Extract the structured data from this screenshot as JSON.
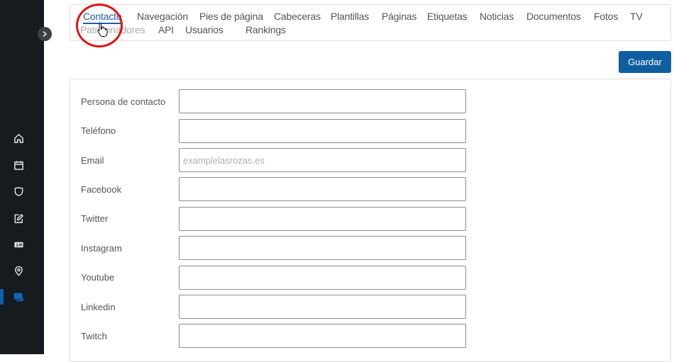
{
  "sidebar": {
    "toggle_icon": "chevron-right-icon",
    "items": [
      {
        "name": "home",
        "icon": "home-icon",
        "active": false
      },
      {
        "name": "calendar",
        "icon": "calendar-icon",
        "active": false
      },
      {
        "name": "shield",
        "icon": "shield-icon",
        "active": false
      },
      {
        "name": "edit",
        "icon": "edit-icon",
        "active": false
      },
      {
        "name": "ticket",
        "icon": "ticket-icon",
        "active": false
      },
      {
        "name": "location",
        "icon": "location-pin-icon",
        "active": false
      },
      {
        "name": "web-settings",
        "icon": "monitor-settings-icon",
        "active": true
      }
    ],
    "accent_color": "#0f5fa8"
  },
  "tabs": [
    {
      "label": "Contacto",
      "active": true
    },
    {
      "label": "Navegación"
    },
    {
      "label": "Pies de página"
    },
    {
      "label": "Cabeceras"
    },
    {
      "label": "Plantillas"
    },
    {
      "label": "Páginas"
    },
    {
      "label": "Etiquetas"
    },
    {
      "label": "Noticias"
    },
    {
      "label": "Documentos"
    },
    {
      "label": "Fotos"
    },
    {
      "label": "TV"
    },
    {
      "label": "Patrocinadores"
    },
    {
      "label": "API"
    },
    {
      "label": "Usuarios"
    },
    {
      "label": "Rankings"
    }
  ],
  "toolbar": {
    "save_label": "Guardar"
  },
  "form": {
    "fields": [
      {
        "label": "Persona de contacto",
        "value": "",
        "placeholder": ""
      },
      {
        "label": "Teléfono",
        "value": "",
        "placeholder": ""
      },
      {
        "label": "Email",
        "value": "",
        "placeholder": "examplelasrozas.es"
      },
      {
        "label": "Facebook",
        "value": "",
        "placeholder": ""
      },
      {
        "label": "Twitter",
        "value": "",
        "placeholder": ""
      },
      {
        "label": "Instagram",
        "value": "",
        "placeholder": ""
      },
      {
        "label": "Youtube",
        "value": "",
        "placeholder": ""
      },
      {
        "label": "Linkedin",
        "value": "",
        "placeholder": ""
      },
      {
        "label": "Twitch",
        "value": "",
        "placeholder": ""
      }
    ]
  },
  "colors": {
    "primary": "#0f5fa0",
    "sidebar_bg": "#161b20",
    "annotation": "#e01212"
  }
}
